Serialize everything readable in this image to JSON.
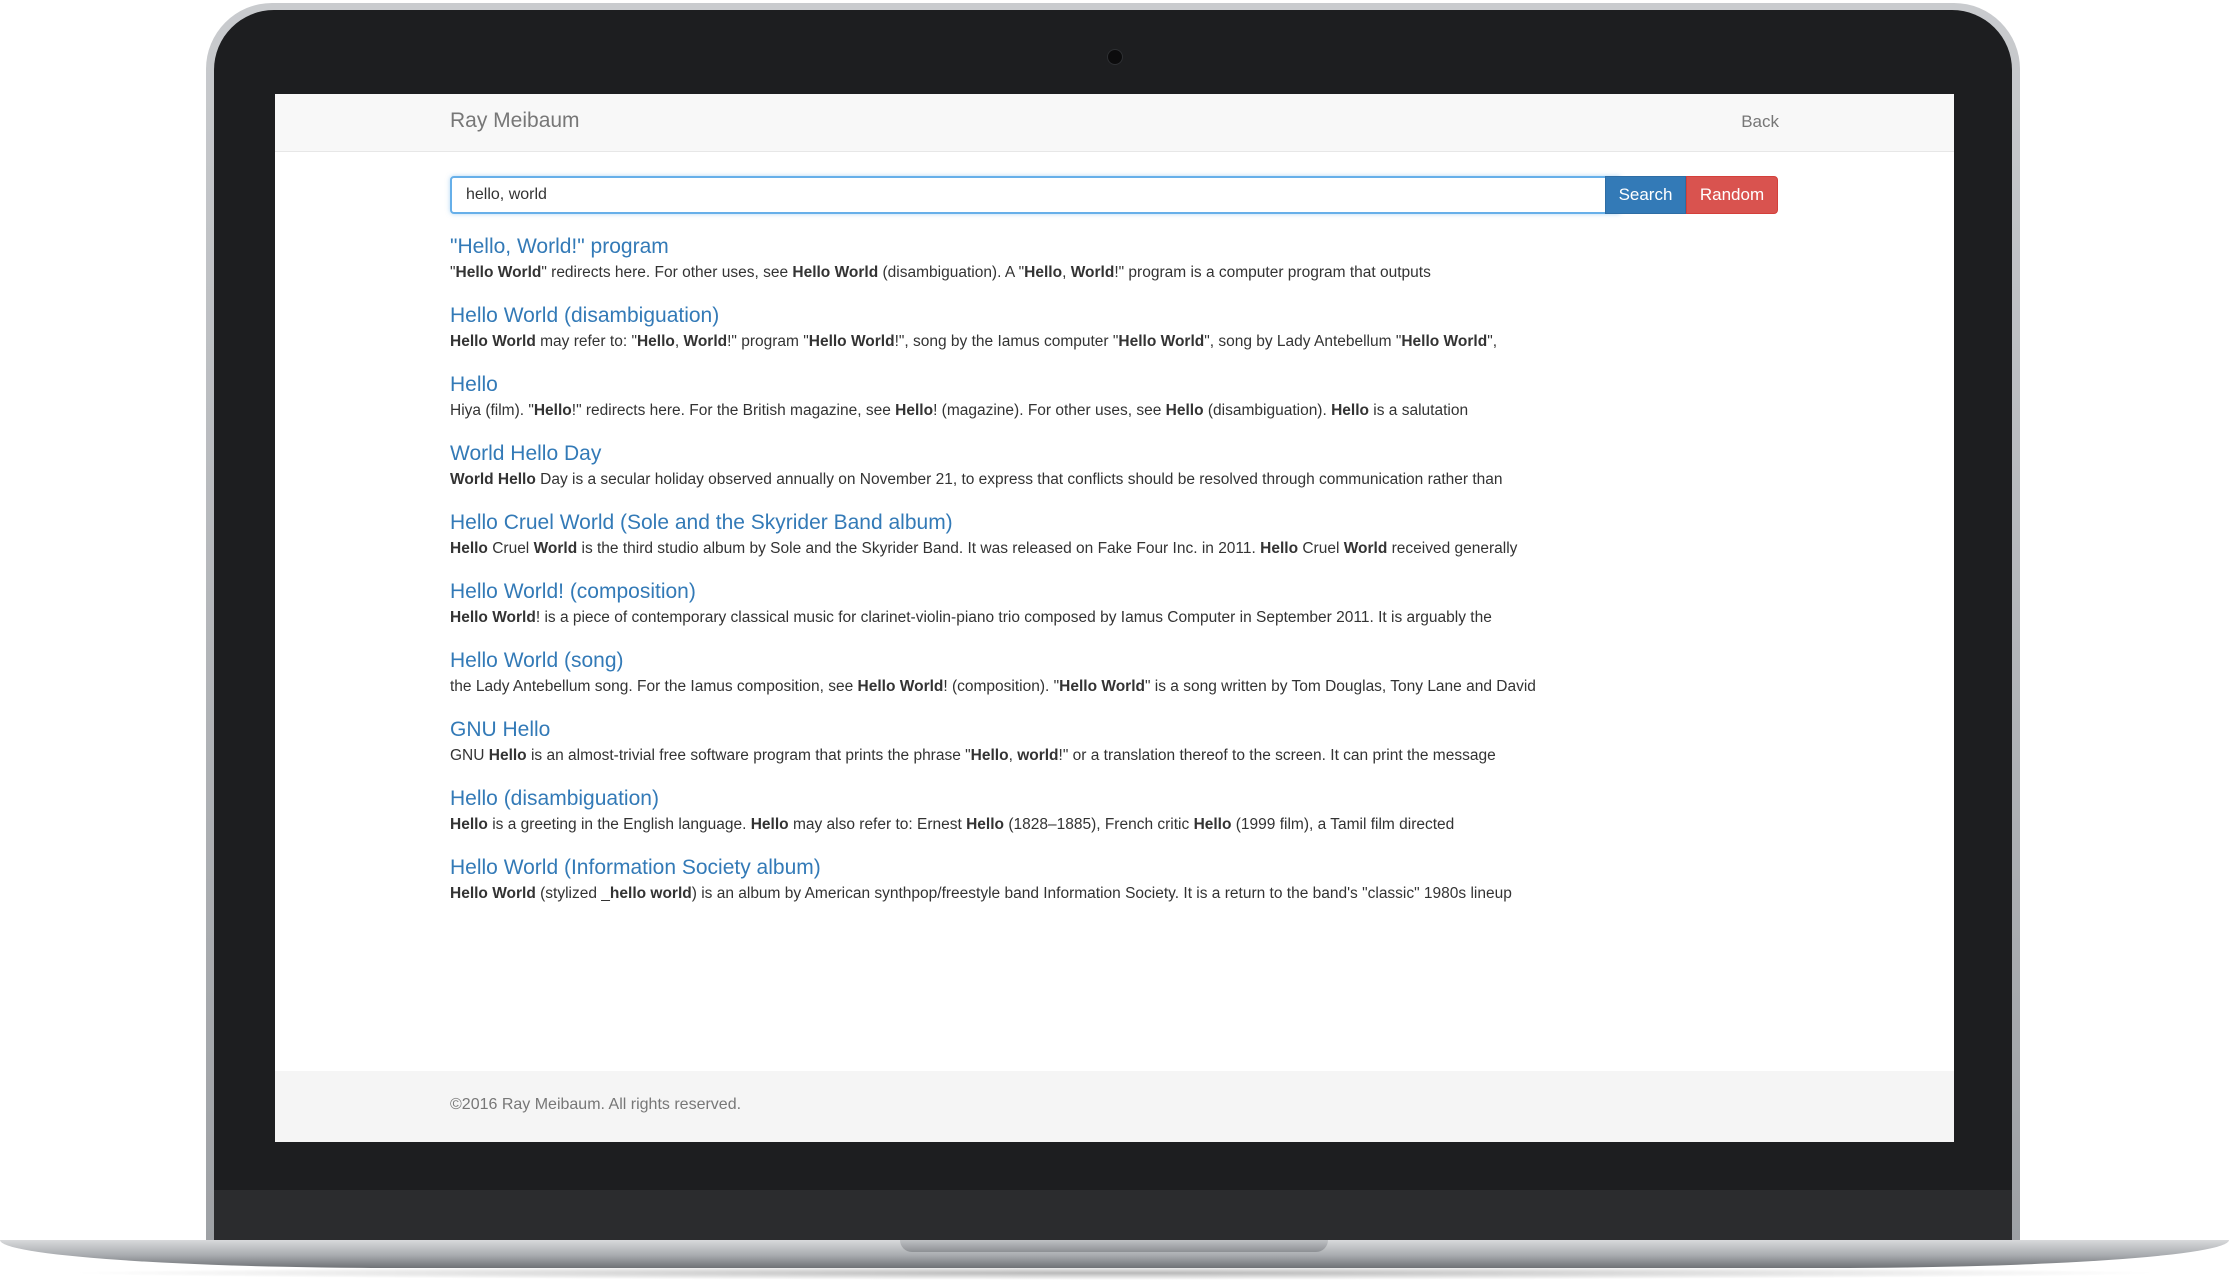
{
  "navbar": {
    "brand": "Ray Meibaum",
    "back_label": "Back"
  },
  "search": {
    "value": "hello, world",
    "search_label": "Search",
    "random_label": "Random"
  },
  "results": [
    {
      "title": "\"Hello, World!\" program",
      "snippet": [
        [
          "\"",
          false
        ],
        [
          "Hello World",
          true
        ],
        [
          "\" redirects here. For other uses, see ",
          false
        ],
        [
          "Hello World",
          true
        ],
        [
          " (disambiguation). A \"",
          false
        ],
        [
          "Hello",
          true
        ],
        [
          ", ",
          false
        ],
        [
          "World",
          true
        ],
        [
          "!\" program is a computer program that outputs",
          false
        ]
      ]
    },
    {
      "title": "Hello World (disambiguation)",
      "snippet": [
        [
          "Hello World",
          true
        ],
        [
          " may refer to: \"",
          false
        ],
        [
          "Hello",
          true
        ],
        [
          ", ",
          false
        ],
        [
          "World",
          true
        ],
        [
          "!\" program \"",
          false
        ],
        [
          "Hello World",
          true
        ],
        [
          "!\", song by the Iamus computer \"",
          false
        ],
        [
          "Hello World",
          true
        ],
        [
          "\", song by Lady Antebellum \"",
          false
        ],
        [
          "Hello World",
          true
        ],
        [
          "\",",
          false
        ]
      ]
    },
    {
      "title": "Hello",
      "snippet": [
        [
          "Hiya (film). \"",
          false
        ],
        [
          "Hello",
          true
        ],
        [
          "!\" redirects here. For the British magazine, see ",
          false
        ],
        [
          "Hello",
          true
        ],
        [
          "! (magazine). For other uses, see ",
          false
        ],
        [
          "Hello",
          true
        ],
        [
          " (disambiguation). ",
          false
        ],
        [
          "Hello",
          true
        ],
        [
          " is a salutation",
          false
        ]
      ]
    },
    {
      "title": "World Hello Day",
      "snippet": [
        [
          "World Hello",
          true
        ],
        [
          " Day is a secular holiday observed annually on November 21, to express that conflicts should be resolved through communication rather than",
          false
        ]
      ]
    },
    {
      "title": "Hello Cruel World (Sole and the Skyrider Band album)",
      "snippet": [
        [
          "Hello",
          true
        ],
        [
          " Cruel ",
          false
        ],
        [
          "World",
          true
        ],
        [
          " is the third studio album by Sole and the Skyrider Band. It was released on Fake Four Inc. in 2011. ",
          false
        ],
        [
          "Hello",
          true
        ],
        [
          " Cruel ",
          false
        ],
        [
          "World",
          true
        ],
        [
          " received generally",
          false
        ]
      ]
    },
    {
      "title": "Hello World! (composition)",
      "snippet": [
        [
          "Hello World",
          true
        ],
        [
          "! is a piece of contemporary classical music for clarinet-violin-piano trio composed by Iamus Computer in September 2011. It is arguably the",
          false
        ]
      ]
    },
    {
      "title": "Hello World (song)",
      "snippet": [
        [
          "the Lady Antebellum song. For the Iamus composition, see ",
          false
        ],
        [
          "Hello World",
          true
        ],
        [
          "! (composition). \"",
          false
        ],
        [
          "Hello World",
          true
        ],
        [
          "\" is a song written by Tom Douglas, Tony Lane and David",
          false
        ]
      ]
    },
    {
      "title": "GNU Hello",
      "snippet": [
        [
          "GNU ",
          false
        ],
        [
          "Hello",
          true
        ],
        [
          " is an almost-trivial free software program that prints the phrase \"",
          false
        ],
        [
          "Hello",
          true
        ],
        [
          ", ",
          false
        ],
        [
          "world",
          true
        ],
        [
          "!\" or a translation thereof to the screen. It can print the message",
          false
        ]
      ]
    },
    {
      "title": "Hello (disambiguation)",
      "snippet": [
        [
          "Hello",
          true
        ],
        [
          " is a greeting in the English language. ",
          false
        ],
        [
          "Hello",
          true
        ],
        [
          " may also refer to: Ernest ",
          false
        ],
        [
          "Hello",
          true
        ],
        [
          " (1828–1885), French critic ",
          false
        ],
        [
          "Hello",
          true
        ],
        [
          " (1999 film), a Tamil film directed",
          false
        ]
      ]
    },
    {
      "title": "Hello World (Information Society album)",
      "snippet": [
        [
          "Hello World",
          true
        ],
        [
          " (stylized _",
          false
        ],
        [
          "hello world",
          true
        ],
        [
          ") is an album by American synthpop/freestyle band Information Society. It is a return to the band's \"classic\" 1980s lineup",
          false
        ]
      ]
    }
  ],
  "footer": {
    "text": "©2016 Ray Meibaum. All rights reserved."
  },
  "colors": {
    "link": "#337ab7",
    "search_button": "#337ab7",
    "random_button": "#d9534f",
    "navbar_bg": "#f8f8f8",
    "footer_bg": "#f5f5f5",
    "laptop_bezel": "#1d1e20"
  }
}
